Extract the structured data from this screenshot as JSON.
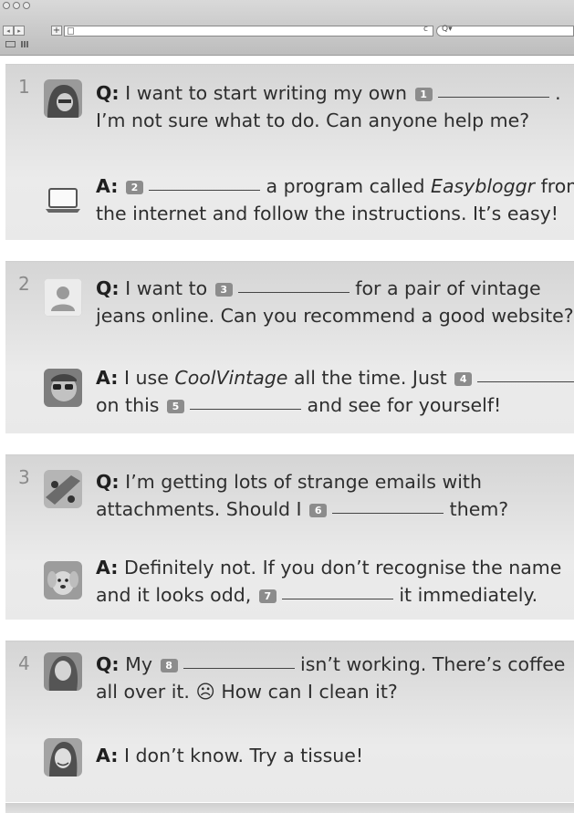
{
  "browser": {
    "back_glyph": "◂",
    "forward_glyph": "▸",
    "new_tab_glyph": "+",
    "reload_glyph": "c",
    "search_glyph": "Q▾"
  },
  "posts": [
    {
      "number": "1",
      "q_avatar": "hooded-person-icon",
      "question": {
        "label": "Q:",
        "line1_before": "I want to start writing my own",
        "blank_num": "1",
        "line1_after": ".",
        "line2": "I’m not sure what to do. Can anyone help me?"
      },
      "a_avatar": "laptop-icon",
      "answer": {
        "label": "A:",
        "blank_num": "2",
        "line1_after_pre": "a program called",
        "line1_italic": "Easybloggr",
        "line1_after_post": "from",
        "line2": "the internet and follow the instructions. It’s easy!"
      }
    },
    {
      "number": "2",
      "q_avatar": "default-user-icon",
      "question": {
        "label": "Q:",
        "line1_before": "I want to",
        "blank_num": "3",
        "line1_after": "for a pair of vintage",
        "line2": "jeans online. Can you recommend a good website?"
      },
      "a_avatar": "sunglasses-person-icon",
      "answer": {
        "label": "A:",
        "line1_before": "I use",
        "line1_italic": "CoolVintage",
        "line1_after": "all the time. Just",
        "blank_num_a": "4",
        "line2_before": "on this",
        "blank_num_b": "5",
        "line2_after": "and see for yourself!"
      }
    },
    {
      "number": "3",
      "q_avatar": "skateboard-icon",
      "question": {
        "label": "Q:",
        "line1": "I’m getting lots of strange emails with",
        "line2_before": "attachments. Should I",
        "blank_num": "6",
        "line2_after": "them?"
      },
      "a_avatar": "puppy-icon",
      "answer": {
        "label": "A:",
        "line1": "Definitely not. If you don’t recognise the name",
        "line2_before": "and it looks odd,",
        "blank_num": "7",
        "line2_after": "it immediately."
      }
    },
    {
      "number": "4",
      "q_avatar": "woman-portrait-icon",
      "question": {
        "label": "Q:",
        "line1_before": "My",
        "blank_num": "8",
        "line1_after": "isn’t working. There’s coffee",
        "line2": "all over it. ☹ How can I clean it?"
      },
      "a_avatar": "smiling-woman-icon",
      "answer": {
        "label": "A:",
        "line1": "I don’t know. Try a tissue!"
      }
    }
  ]
}
